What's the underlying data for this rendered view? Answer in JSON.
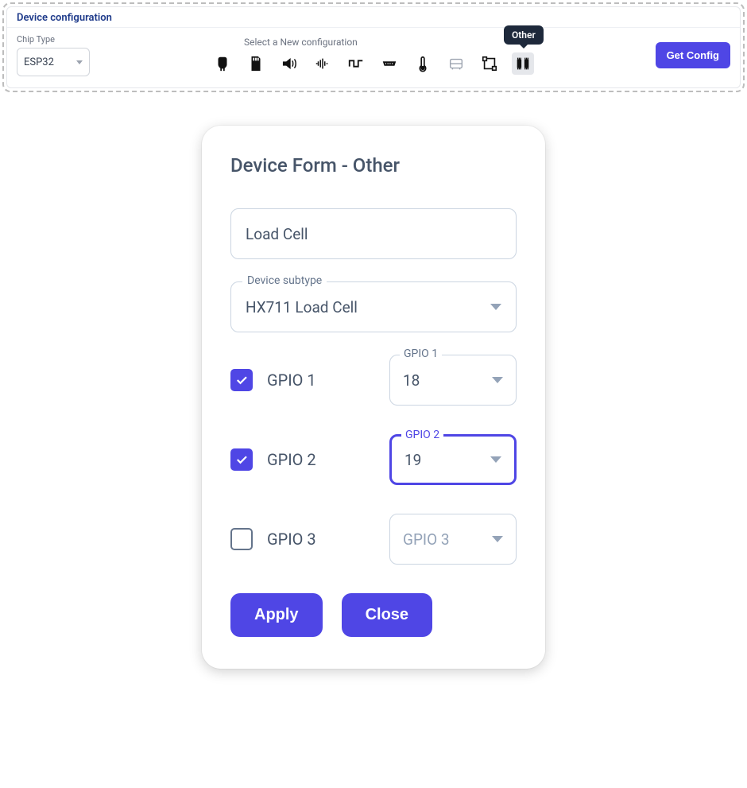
{
  "panel": {
    "title": "Device configuration",
    "chip_label": "Chip Type",
    "chip_value": "ESP32",
    "config_label": "Select a New configuration",
    "tooltip": "Other",
    "get_config": "Get Config",
    "icons": [
      {
        "name": "led-icon"
      },
      {
        "name": "sd-card-icon"
      },
      {
        "name": "audio-out-icon"
      },
      {
        "name": "audio-in-icon"
      },
      {
        "name": "square-wave-icon"
      },
      {
        "name": "serial-port-icon"
      },
      {
        "name": "thermometer-icon"
      },
      {
        "name": "bus-icon"
      },
      {
        "name": "transform-icon"
      },
      {
        "name": "chip-other-icon"
      }
    ]
  },
  "dialog": {
    "title": "Device Form - Other",
    "device_name": "Load Cell",
    "subtype_label": "Device subtype",
    "subtype_value": "HX711 Load Cell",
    "gpio": [
      {
        "label": "GPIO 1",
        "float": "GPIO 1",
        "value": "18",
        "checked": true,
        "focused": false
      },
      {
        "label": "GPIO 2",
        "float": "GPIO 2",
        "value": "19",
        "checked": true,
        "focused": true
      },
      {
        "label": "GPIO 3",
        "float": "",
        "value": "GPIO 3",
        "checked": false,
        "focused": false,
        "placeholder": true
      }
    ],
    "apply": "Apply",
    "close": "Close"
  }
}
